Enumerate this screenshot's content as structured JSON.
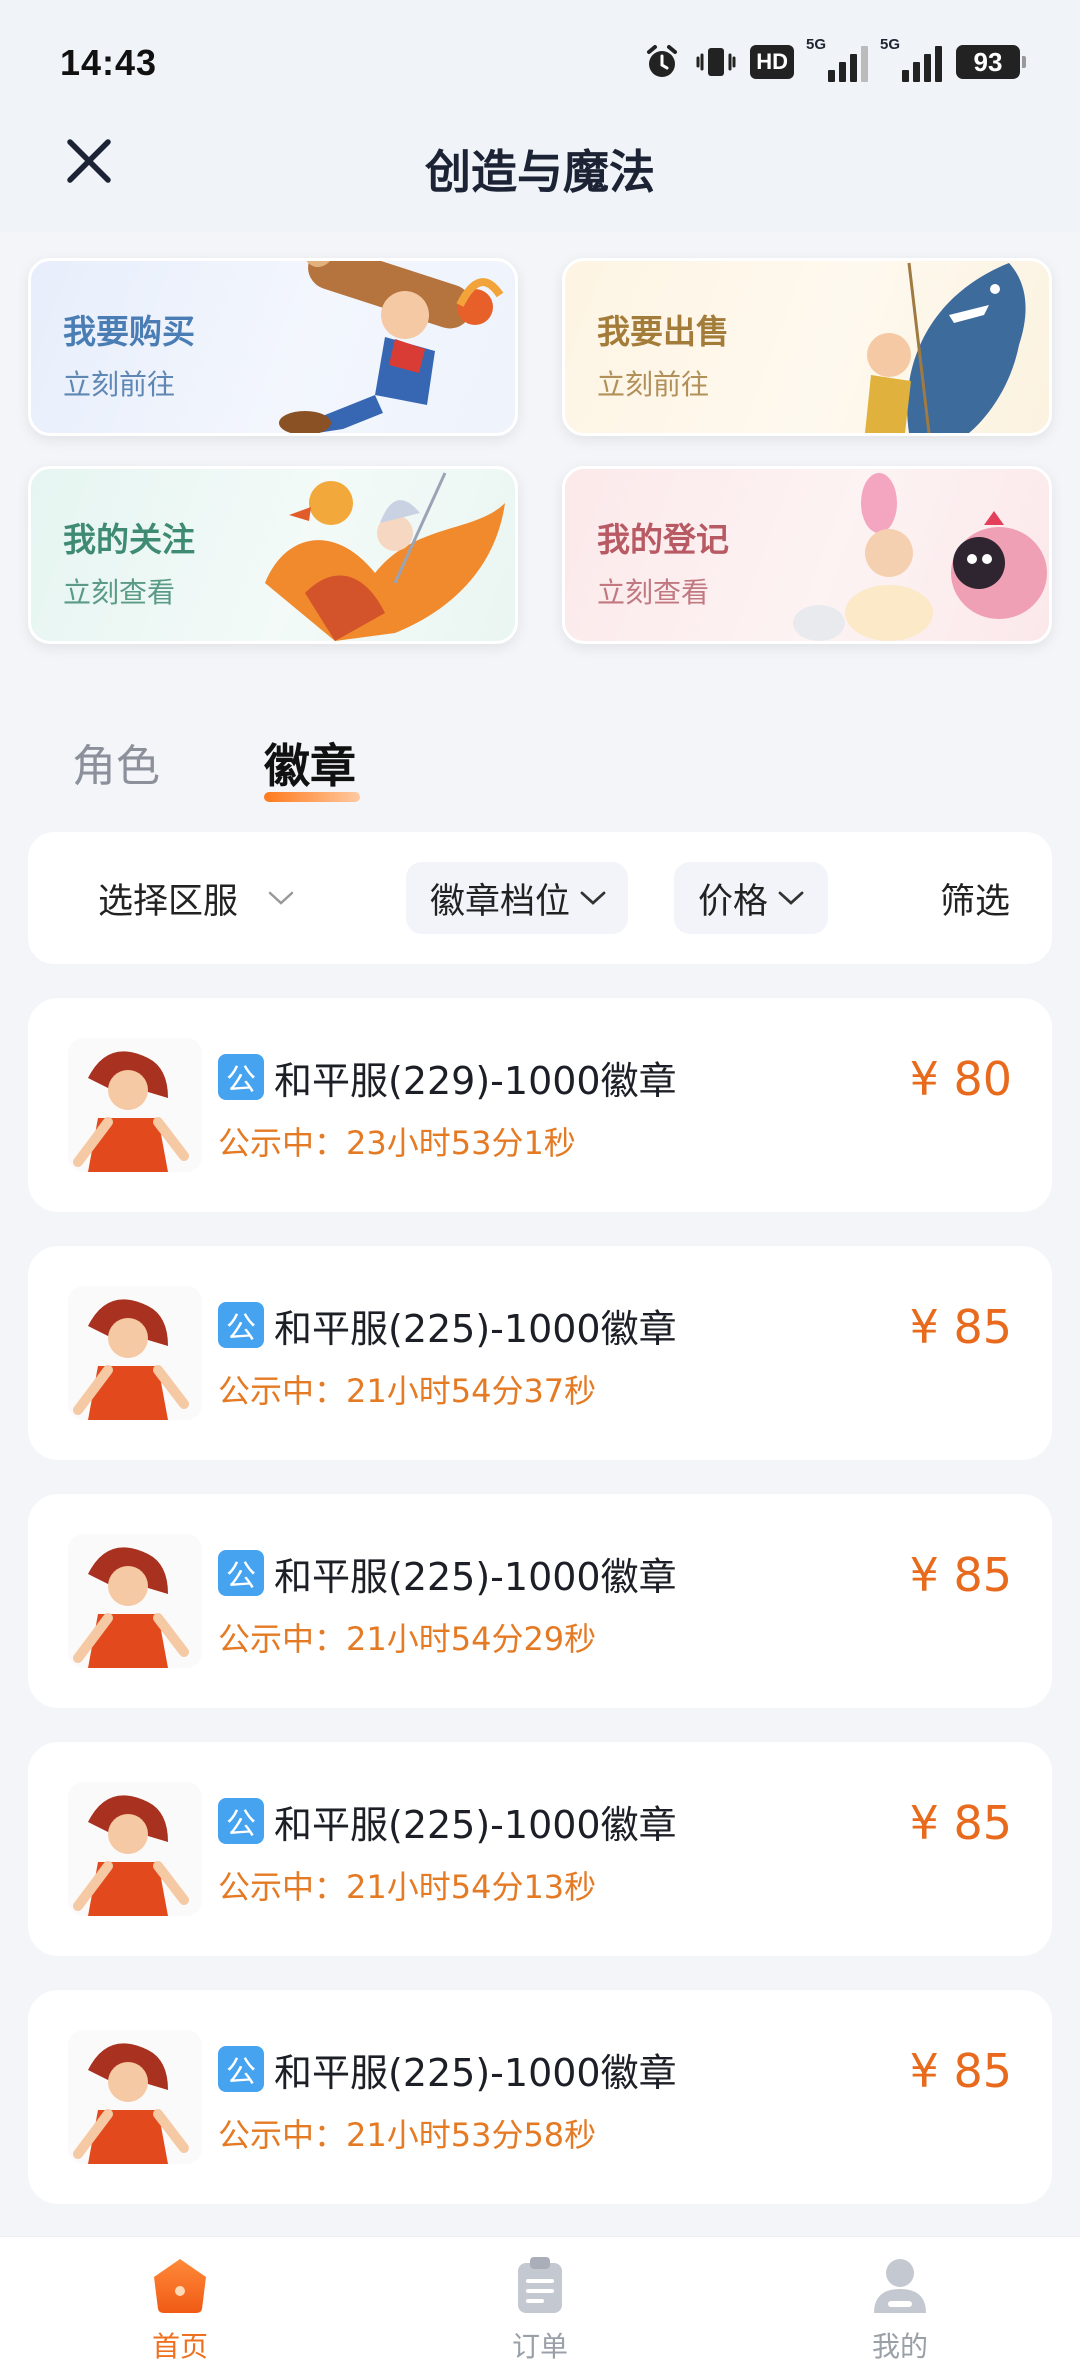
{
  "status_bar": {
    "time": "14:43",
    "hd": "HD",
    "net1": "5G",
    "net2": "5G",
    "battery": "93"
  },
  "header": {
    "title": "创造与魔法"
  },
  "quick_cards": [
    {
      "title": "我要购买",
      "subtitle": "立刻前往"
    },
    {
      "title": "我要出售",
      "subtitle": "立刻前往"
    },
    {
      "title": "我的关注",
      "subtitle": "立刻查看"
    },
    {
      "title": "我的登记",
      "subtitle": "立刻查看"
    }
  ],
  "tabs": [
    {
      "label": "角色",
      "active": false
    },
    {
      "label": "徽章",
      "active": true
    }
  ],
  "filters": {
    "region": "选择区服",
    "tier": "徽章档位",
    "price": "价格",
    "filter": "筛选"
  },
  "listings": [
    {
      "badge": "公",
      "title": "和平服(229)-1000徽章",
      "status": "公示中：23小时53分1秒",
      "price": "¥ 80"
    },
    {
      "badge": "公",
      "title": "和平服(225)-1000徽章",
      "status": "公示中：21小时54分37秒",
      "price": "¥ 85"
    },
    {
      "badge": "公",
      "title": "和平服(225)-1000徽章",
      "status": "公示中：21小时54分29秒",
      "price": "¥ 85"
    },
    {
      "badge": "公",
      "title": "和平服(225)-1000徽章",
      "status": "公示中：21小时54分13秒",
      "price": "¥ 85"
    },
    {
      "badge": "公",
      "title": "和平服(225)-1000徽章",
      "status": "公示中：21小时53分58秒",
      "price": "¥ 85"
    }
  ],
  "bottom_nav": [
    {
      "label": "首页",
      "active": true
    },
    {
      "label": "订单",
      "active": false
    },
    {
      "label": "我的",
      "active": false
    }
  ],
  "colors": {
    "accent": "#ef7120",
    "price": "#e86a1c",
    "badge": "#45a3f0"
  }
}
